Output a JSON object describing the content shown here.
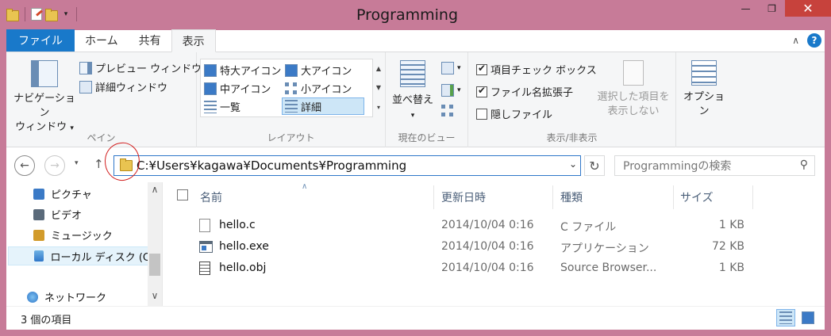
{
  "window": {
    "title": "Programming",
    "close_glyph": "✕",
    "min_glyph": "—",
    "max_glyph": "❐"
  },
  "ribbon_tabs": {
    "file": "ファイル",
    "home": "ホーム",
    "share": "共有",
    "view": "表示"
  },
  "ribbon": {
    "pane_group": {
      "nav_pane_line1": "ナビゲーション",
      "nav_pane_line2": "ウィンドウ",
      "preview_pane": "プレビュー ウィンドウ",
      "details_pane": "詳細ウィンドウ",
      "label": "ペイン"
    },
    "layout_group": {
      "extra_large_icons": "特大アイコン",
      "large_icons": "大アイコン",
      "medium_icons": "中アイコン",
      "small_icons": "小アイコン",
      "list": "一覧",
      "details": "詳細",
      "label": "レイアウト"
    },
    "current_view_group": {
      "sort_by": "並べ替え",
      "label": "現在のビュー"
    },
    "show_hide_group": {
      "item_check_boxes": "項目チェック ボックス",
      "file_name_extensions": "ファイル名拡張子",
      "hidden_items": "隠しファイル",
      "hide_selected_line1": "選択した項目を",
      "hide_selected_line2": "表示しない",
      "label": "表示/非表示",
      "item_check_boxes_checked": true,
      "file_name_extensions_checked": true,
      "hidden_items_checked": false
    },
    "options": "オプション"
  },
  "address": {
    "path": "C:¥Users¥kagawa¥Documents¥Programming",
    "search_placeholder": "Programmingの検索"
  },
  "nav_pane": {
    "items": [
      {
        "label": "ピクチャ",
        "icon": "pictures-icon"
      },
      {
        "label": "ビデオ",
        "icon": "videos-icon"
      },
      {
        "label": "ミュージック",
        "icon": "music-icon"
      },
      {
        "label": "ローカル ディスク (C",
        "icon": "drive-icon"
      },
      {
        "label": "ネットワーク",
        "icon": "network-icon"
      }
    ]
  },
  "file_list": {
    "columns": {
      "name": "名前",
      "date": "更新日時",
      "type": "種類",
      "size": "サイズ"
    },
    "rows": [
      {
        "name": "hello.c",
        "date": "2014/10/04 0:16",
        "type": "C ファイル",
        "size": "1 KB",
        "icon": "c-file-icon"
      },
      {
        "name": "hello.exe",
        "date": "2014/10/04 0:16",
        "type": "アプリケーション",
        "size": "72 KB",
        "icon": "exe-icon"
      },
      {
        "name": "hello.obj",
        "date": "2014/10/04 0:16",
        "type": "Source Browser...",
        "size": "1 KB",
        "icon": "obj-file-icon"
      }
    ]
  },
  "status": {
    "item_count": "3 個の項目"
  },
  "colors": {
    "title_bar": "#c77b98",
    "file_tab": "#1979ca",
    "close_button": "#c7423c",
    "annotation_circle": "#d21e1e"
  }
}
